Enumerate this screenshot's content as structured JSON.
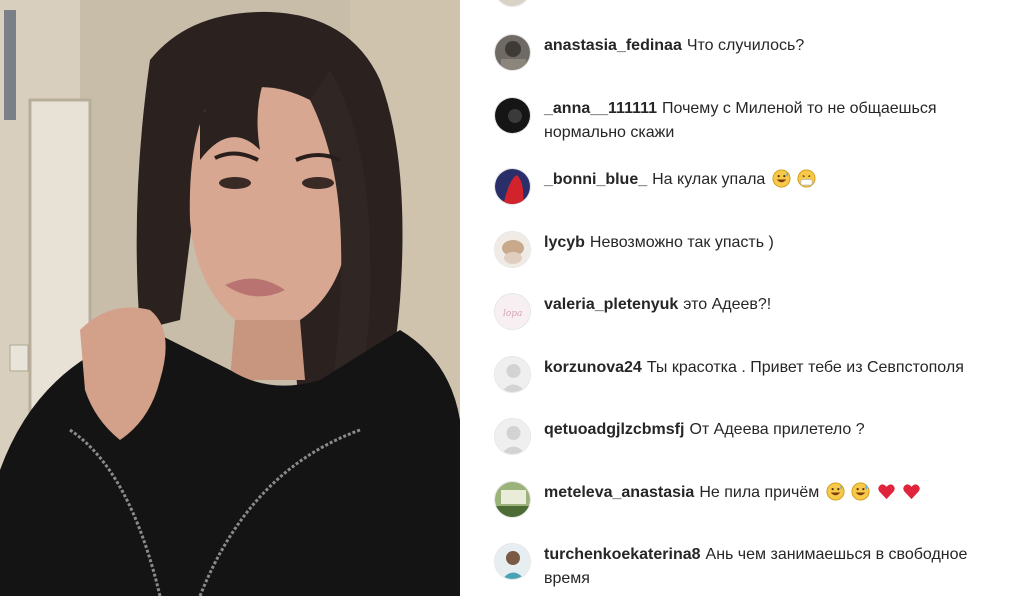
{
  "video": {
    "description_icon": "live-video-frame"
  },
  "comments": [
    {
      "username": "anastasia_fedinaa",
      "text": "Что случилось?",
      "avatar": "avatar-photo-icon",
      "emojis": []
    },
    {
      "username": "_anna__111111",
      "text": "Почему с Миленой то не общаешься нормально скажи",
      "avatar": "avatar-photo-icon",
      "emojis": []
    },
    {
      "username": "_bonni_blue_",
      "text": "На кулак упала",
      "avatar": "avatar-photo-icon",
      "emojis": [
        "grinning-sweat-emoji",
        "sneezing-face-emoji"
      ]
    },
    {
      "username": "lycyb",
      "text": "Невозможно так упасть )",
      "avatar": "avatar-photo-icon",
      "emojis": []
    },
    {
      "username": "valeria_pletenyuk",
      "text": "это Адеев?!",
      "avatar": "avatar-photo-icon",
      "emojis": []
    },
    {
      "username": "korzunova24",
      "text": "Ты красотка . Привет тебе из Севпстополя",
      "avatar": "default-avatar-icon",
      "emojis": []
    },
    {
      "username": "qetuoadgjlzcbmsfj",
      "text": "От Адеева прилетело ?",
      "avatar": "default-avatar-icon",
      "emojis": []
    },
    {
      "username": "meteleva_anastasia",
      "text": "Не пила причём",
      "avatar": "avatar-photo-icon",
      "emojis": [
        "grinning-sweat-emoji",
        "grinning-sweat-emoji",
        "red-heart-emoji",
        "red-heart-emoji"
      ]
    },
    {
      "username": "turchenkoekaterina8",
      "text": "Ань чем занимаешься в свободное время",
      "avatar": "avatar-photo-icon",
      "emojis": []
    }
  ],
  "colors": {
    "text": "#262626",
    "heart": "#e0243c",
    "emoji_face": "#f7c948"
  }
}
